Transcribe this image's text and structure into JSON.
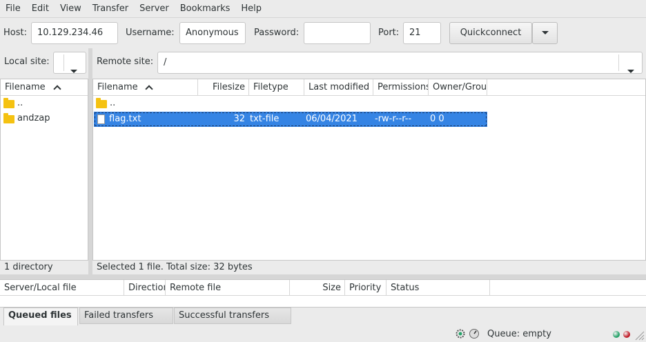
{
  "menu": [
    "File",
    "Edit",
    "View",
    "Transfer",
    "Server",
    "Bookmarks",
    "Help"
  ],
  "quickconnect": {
    "host_label": "Host:",
    "host_value": "10.129.234.46",
    "username_label": "Username:",
    "username_value": "Anonymous",
    "password_label": "Password:",
    "password_value": "",
    "port_label": "Port:",
    "port_value": "21",
    "button_label": "Quickconnect"
  },
  "local": {
    "site_label": "Local site:",
    "site_value": "",
    "header": "Filename",
    "rows": [
      {
        "name": ".."
      },
      {
        "name": "andzap"
      }
    ],
    "status": "1 directory"
  },
  "remote": {
    "site_label": "Remote site:",
    "site_value": "/",
    "headers": {
      "filename": "Filename",
      "filesize": "Filesize",
      "filetype": "Filetype",
      "modified": "Last modified",
      "permissions": "Permissions",
      "owner": "Owner/Group"
    },
    "parent": "..",
    "files": [
      {
        "name": "flag.txt",
        "size": "32",
        "type": "txt-file",
        "modified": "06/04/2021",
        "permissions": "-rw-r--r--",
        "owner": "0 0"
      }
    ],
    "status": "Selected 1 file. Total size: 32 bytes"
  },
  "queue": {
    "headers": {
      "server": "Server/Local file",
      "direction": "Direction",
      "remote": "Remote file",
      "size": "Size",
      "priority": "Priority",
      "status": "Status"
    },
    "tabs": [
      "Queued files",
      "Failed transfers",
      "Successful transfers"
    ],
    "active_tab": "Queued files"
  },
  "statusbar": {
    "queue_text": "Queue: empty",
    "led_colors": [
      "#26a269",
      "#c01c28"
    ]
  },
  "colors": {
    "selection": "#3584e4",
    "folder": "#f5c211"
  }
}
